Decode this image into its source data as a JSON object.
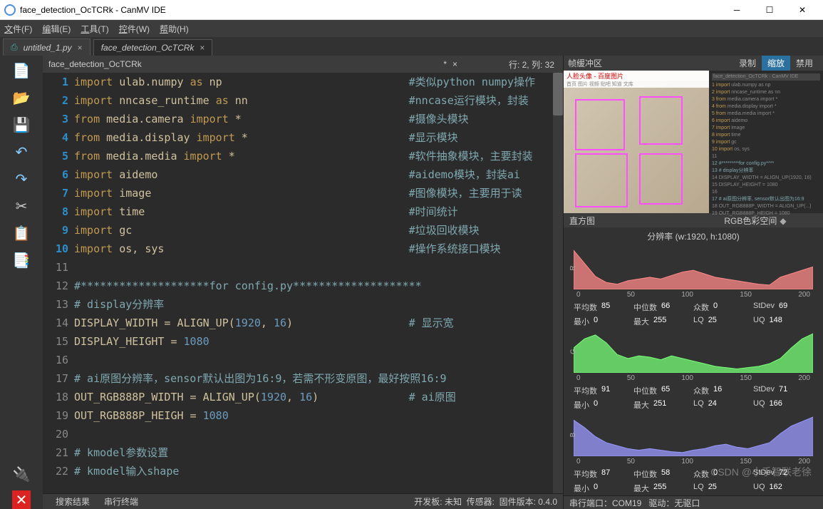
{
  "window": {
    "title": "face_detection_OcTCRk - CanMV IDE"
  },
  "menu": [
    "文件(F)",
    "编辑(E)",
    "工具(T)",
    "控件(W)",
    "帮助(H)"
  ],
  "tabs": [
    {
      "icon": "⎙",
      "label": "untitled_1.py",
      "active": false
    },
    {
      "icon": "",
      "label": "face_detection_OcTCRk",
      "active": true
    }
  ],
  "fileheader": {
    "name": "face_detection_OcTCRk",
    "dirty": "*"
  },
  "position": "行: 2, 列: 32",
  "code_lines": [
    {
      "n": 1,
      "hl": true,
      "t": "import ulab.numpy as np",
      "c": "#类似python numpy操作"
    },
    {
      "n": 2,
      "hl": true,
      "t": "import nncase_runtime as nn",
      "c": "#nncase运行模块，封装"
    },
    {
      "n": 3,
      "hl": true,
      "t": "from media.camera import *",
      "c": "#摄像头模块"
    },
    {
      "n": 4,
      "hl": true,
      "t": "from media.display import *",
      "c": "#显示模块"
    },
    {
      "n": 5,
      "hl": true,
      "t": "from media.media import *",
      "c": "#软件抽象模块，主要封装"
    },
    {
      "n": 6,
      "hl": true,
      "t": "import aidemo",
      "c": "#aidemo模块，封装ai"
    },
    {
      "n": 7,
      "hl": true,
      "t": "import image",
      "c": "#图像模块，主要用于读"
    },
    {
      "n": 8,
      "hl": true,
      "t": "import time",
      "c": "#时间统计"
    },
    {
      "n": 9,
      "hl": true,
      "t": "import gc",
      "c": "#垃圾回收模块"
    },
    {
      "n": 10,
      "hl": true,
      "t": "import os, sys",
      "c": "#操作系统接口模块"
    },
    {
      "n": 11,
      "t": ""
    },
    {
      "n": 12,
      "c": "#********************for config.py********************"
    },
    {
      "n": 13,
      "c": "# display分辨率"
    },
    {
      "n": 14,
      "t": "DISPLAY_WIDTH = ALIGN_UP(1920, 16)",
      "c": "# 显示宽"
    },
    {
      "n": 15,
      "t": "DISPLAY_HEIGHT = 1080"
    },
    {
      "n": 16,
      "t": ""
    },
    {
      "n": 17,
      "c": "# ai原图分辨率，sensor默认出图为16:9，若需不形变原图，最好按照16:9"
    },
    {
      "n": 18,
      "t": "OUT_RGB888P_WIDTH = ALIGN_UP(1920, 16)",
      "c": "# ai原图"
    },
    {
      "n": 19,
      "t": "OUT_RGB888P_HEIGH = 1080"
    },
    {
      "n": 20,
      "t": ""
    },
    {
      "n": 21,
      "c": "# kmodel参数设置"
    },
    {
      "n": 22,
      "c": "# kmodel输入shape"
    }
  ],
  "framebuffer": {
    "label": "帧缓冲区",
    "banner": "人脸头像 - 百度图片",
    "nav": "首页  图片  视频  贴吧  知道  文库",
    "buttons": [
      "录制",
      "缩放",
      "禁用"
    ],
    "active": "缩放"
  },
  "histogram": {
    "label": "直方图",
    "colorspace": "RGB色彩空间",
    "resolution": "分辨率 (w:1920, h:1080)"
  },
  "chart_data": [
    {
      "type": "area",
      "channel": "R",
      "color": "#ff8888",
      "x": [
        0,
        50,
        100,
        150,
        200
      ],
      "xrange": [
        0,
        225
      ],
      "stats": {
        "平均数": 85,
        "中位数": 66,
        "众数": 0,
        "StDev": 69,
        "最小": 0,
        "最大": 255,
        "LQ": 25,
        "UQ": 148
      },
      "values": [
        45,
        30,
        15,
        8,
        6,
        10,
        12,
        14,
        12,
        16,
        20,
        22,
        18,
        14,
        12,
        10,
        8,
        6,
        5,
        14,
        18,
        22,
        26
      ]
    },
    {
      "type": "area",
      "channel": "G",
      "color": "#77ff77",
      "x": [
        0,
        50,
        100,
        150,
        200
      ],
      "xrange": [
        0,
        225
      ],
      "stats": {
        "平均数": 91,
        "中位数": 65,
        "众数": 16,
        "StDev": 71,
        "最小": 0,
        "最大": 251,
        "LQ": 24,
        "UQ": 166
      },
      "values": [
        38,
        52,
        58,
        46,
        28,
        22,
        26,
        24,
        20,
        26,
        22,
        18,
        14,
        10,
        8,
        6,
        8,
        10,
        14,
        22,
        38,
        52,
        60
      ]
    },
    {
      "type": "area",
      "channel": "B",
      "color": "#9999ff",
      "x": [
        0,
        50,
        100,
        150,
        200
      ],
      "xrange": [
        0,
        225
      ],
      "stats": {
        "平均数": 87,
        "中位数": 58,
        "众数": 0,
        "StDev": 72,
        "最小": 0,
        "最大": 255,
        "LQ": 25,
        "UQ": 162
      },
      "values": [
        48,
        38,
        26,
        18,
        14,
        10,
        8,
        10,
        8,
        6,
        5,
        8,
        10,
        14,
        16,
        12,
        10,
        14,
        18,
        30,
        40,
        46,
        52
      ]
    }
  ],
  "bottom_tabs": [
    "搜索结果",
    "串行终端"
  ],
  "status": {
    "board": "开发板: 未知",
    "sensor": "传感器:",
    "firmware": "固件版本: 0.4.0",
    "serial": "串行端口：COM19",
    "drive": "驱动：无驱口"
  },
  "watermark": "CSDN @小手智联老徐"
}
